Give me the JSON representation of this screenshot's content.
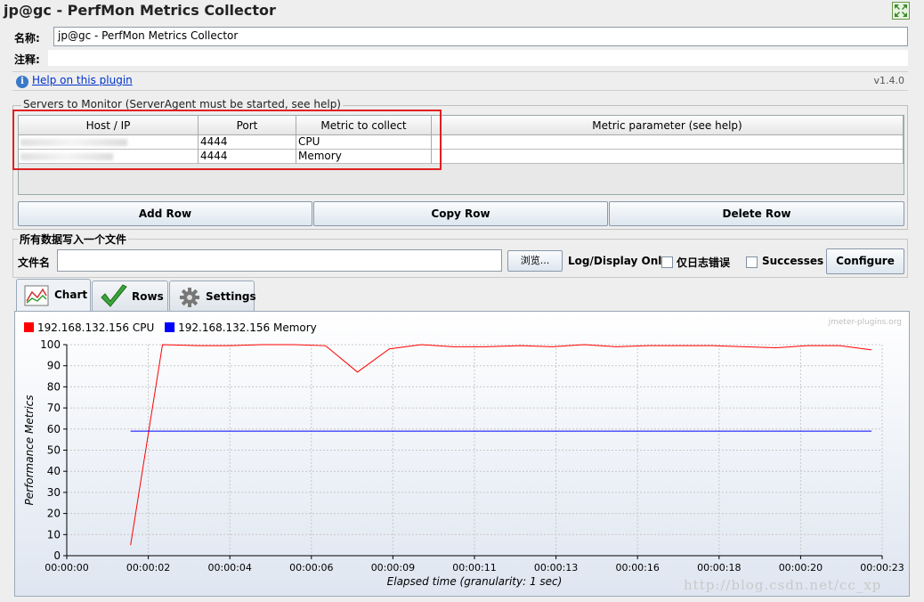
{
  "window": {
    "title": "jp@gc - PerfMon Metrics Collector"
  },
  "form": {
    "name_label": "名称:",
    "name_value": "jp@gc - PerfMon Metrics Collector",
    "comment_label": "注释:",
    "comment_value": ""
  },
  "help": {
    "link": "Help on this plugin",
    "version": "v1.4.0"
  },
  "servers": {
    "group_title": "Servers to Monitor (ServerAgent must be started, see help)",
    "columns": [
      "Host / IP",
      "Port",
      "Metric to collect",
      "Metric parameter (see help)"
    ],
    "rows": [
      {
        "port": "4444",
        "metric": "CPU",
        "param": ""
      },
      {
        "port": "4444",
        "metric": "Memory",
        "param": ""
      }
    ],
    "buttons": {
      "add": "Add Row",
      "copy": "Copy Row",
      "delete": "Delete Row"
    }
  },
  "file": {
    "group_title": "所有数据写入一个文件",
    "file_label": "文件名",
    "file_value": "",
    "browse": "浏览...",
    "log_label": "Log/Display Only:",
    "errors_label": "仅日志错误",
    "errors_checked": false,
    "successes_label": "Successes",
    "successes_checked": false,
    "configure": "Configure"
  },
  "tabs": {
    "chart": "Chart",
    "rows": "Rows",
    "settings": "Settings",
    "active": "chart"
  },
  "colors": {
    "cpu": "#ff0000",
    "memory": "#0000ff",
    "link": "#0033cc",
    "highlight": "#e02020"
  },
  "chart_data": {
    "type": "line",
    "watermark": "jmeter-plugins.org",
    "ylabel": "Performance Metrics",
    "xlabel": "Elapsed time (granularity: 1 sec)",
    "ylim": [
      0,
      100
    ],
    "yticks": [
      0,
      10,
      20,
      30,
      40,
      50,
      60,
      70,
      80,
      90,
      100
    ],
    "xticks": [
      "00:00:00",
      "00:00:02",
      "00:00:04",
      "00:00:06",
      "00:00:09",
      "00:00:11",
      "00:00:13",
      "00:00:16",
      "00:00:18",
      "00:00:20",
      "00:00:23"
    ],
    "xlim_sec": [
      0,
      23
    ],
    "grid": true,
    "legend_position": "top-left",
    "series": [
      {
        "name": "192.168.132.156 CPU",
        "color": "#ff0000",
        "x": [
          1.8,
          2.7,
          3.7,
          4.6,
          5.5,
          6.4,
          7.3,
          8.2,
          9.1,
          10.0,
          10.9,
          11.8,
          12.8,
          13.7,
          14.6,
          15.5,
          16.4,
          17.3,
          18.2,
          19.1,
          20.0,
          20.9,
          21.8,
          22.7
        ],
        "values": [
          5,
          100,
          99.5,
          99.5,
          100,
          100,
          99.5,
          87,
          98,
          100,
          99,
          99,
          99.5,
          99,
          100,
          99,
          99.5,
          99.5,
          99.5,
          99,
          98.5,
          99.5,
          99.5,
          97.5
        ]
      },
      {
        "name": "192.168.132.156 Memory",
        "color": "#0000ff",
        "x": [
          1.8,
          22.7
        ],
        "values": [
          59,
          59
        ]
      }
    ]
  },
  "watermark_url": "http://blog.csdn.net/cc_xp"
}
